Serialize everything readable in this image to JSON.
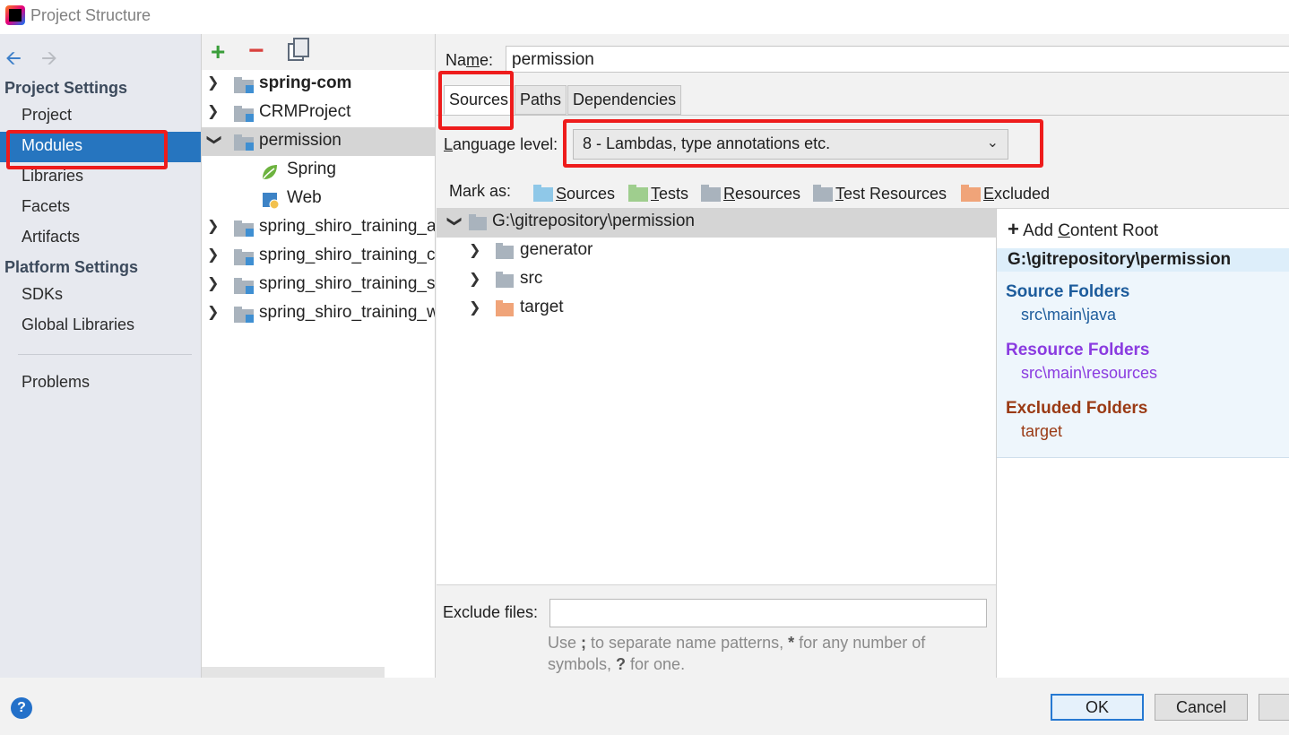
{
  "window": {
    "title": "Project Structure"
  },
  "nav": {
    "project_settings_header": "Project Settings",
    "project_settings_items": [
      "Project",
      "Modules",
      "Libraries",
      "Facets",
      "Artifacts"
    ],
    "platform_settings_header": "Platform Settings",
    "platform_settings_items": [
      "SDKs",
      "Global Libraries"
    ],
    "problems": "Problems",
    "selected": "Modules"
  },
  "modules": {
    "items": [
      {
        "label": "spring-com",
        "bold": true
      },
      {
        "label": "CRMProject"
      },
      {
        "label": "permission",
        "expanded": true,
        "selected": true
      },
      {
        "label": "Spring",
        "child": true
      },
      {
        "label": "Web",
        "child": true
      },
      {
        "label": "spring_shiro_training_a"
      },
      {
        "label": "spring_shiro_training_c"
      },
      {
        "label": "spring_shiro_training_s"
      },
      {
        "label": "spring_shiro_training_w"
      }
    ]
  },
  "main": {
    "name_label_pre": "Na",
    "name_label_mnemonic": "m",
    "name_label_post": "e:",
    "name_value": "permission",
    "tabs": [
      "Sources",
      "Paths",
      "Dependencies"
    ],
    "active_tab": "Sources",
    "language_label_pre": "",
    "language_label_mnemonic": "L",
    "language_label_post": "anguage level:",
    "language_value": "8 - Lambdas, type annotations etc.",
    "mark_as_label": "Mark as:",
    "mark_as": [
      {
        "mnemonic": "S",
        "rest": "ources",
        "color": "#8fc8e8"
      },
      {
        "mnemonic": "T",
        "rest": "ests",
        "color": "#9fce8e"
      },
      {
        "mnemonic": "R",
        "rest": "esources",
        "color": "#a9b3bd"
      },
      {
        "mnemonic": "T",
        "rest": "est Resources",
        "color": "#a9b3bd"
      },
      {
        "mnemonic": "E",
        "rest": "xcluded",
        "color": "#f0a479"
      }
    ],
    "content_tree": {
      "root": "G:\\gitrepository\\permission",
      "children": [
        {
          "label": "generator",
          "color": "#a9b3bd"
        },
        {
          "label": "src",
          "color": "#a9b3bd"
        },
        {
          "label": "target",
          "color": "#f0a479"
        }
      ]
    },
    "exclude_label": "Exclude files:",
    "exclude_value": "",
    "exclude_hint_1": "Use ",
    "exclude_hint_semicolon": ";",
    "exclude_hint_2": " to separate name patterns, ",
    "exclude_hint_star": "*",
    "exclude_hint_3": " for any number of symbols, ",
    "exclude_hint_q": "?",
    "exclude_hint_4": " for one."
  },
  "roots": {
    "add_pre": "Add ",
    "add_mnemonic": "C",
    "add_post": "ontent Root",
    "root_path": "G:\\gitrepository\\permission",
    "source_title": "Source Folders",
    "source_item": "src\\main\\java",
    "source_color": "#1d5c9c",
    "resource_title": "Resource Folders",
    "resource_item": "src\\main\\resources",
    "resource_color": "#8a3be0",
    "excluded_title": "Excluded Folders",
    "excluded_item": "target",
    "excluded_color": "#9a3a14"
  },
  "buttons": {
    "ok": "OK",
    "cancel": "Cancel",
    "help": "?"
  }
}
